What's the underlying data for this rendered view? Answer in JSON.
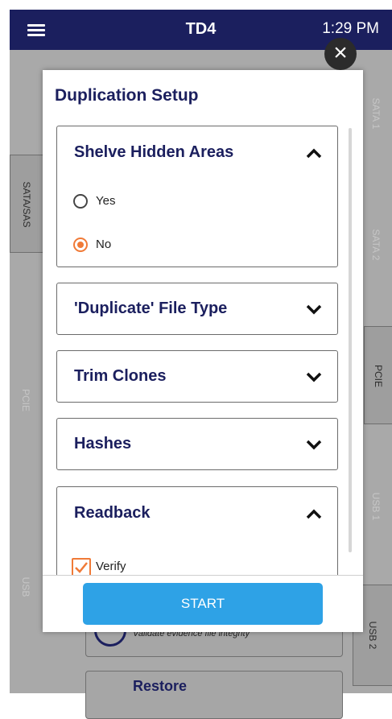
{
  "header": {
    "device_name": "TD4",
    "time": "1:29 PM"
  },
  "background": {
    "left_tabs": [
      "SATA/SAS",
      "PCIE",
      "USB"
    ],
    "right_tabs": [
      "SATA 1",
      "SATA 2",
      "PCIE",
      "USB 1",
      "USB 2"
    ],
    "verify_card": {
      "subtitle": "Validate evidence file integrity"
    },
    "restore_card": {
      "label": "Restore"
    }
  },
  "modal": {
    "title": "Duplication Setup",
    "sections": [
      {
        "title": "Shelve Hidden Areas",
        "expanded": true,
        "options": [
          {
            "label": "Yes",
            "selected": false
          },
          {
            "label": "No",
            "selected": true
          }
        ]
      },
      {
        "title": "'Duplicate' File Type",
        "expanded": false
      },
      {
        "title": "Trim Clones",
        "expanded": false
      },
      {
        "title": "Hashes",
        "expanded": false
      },
      {
        "title": "Readback",
        "expanded": true,
        "options": [
          {
            "label": "Verify",
            "checked": true
          }
        ]
      }
    ],
    "start_label": "START"
  },
  "colors": {
    "navy": "#1b1f5e",
    "accent_orange": "#f07a37",
    "start_blue": "#2ea2e6"
  }
}
